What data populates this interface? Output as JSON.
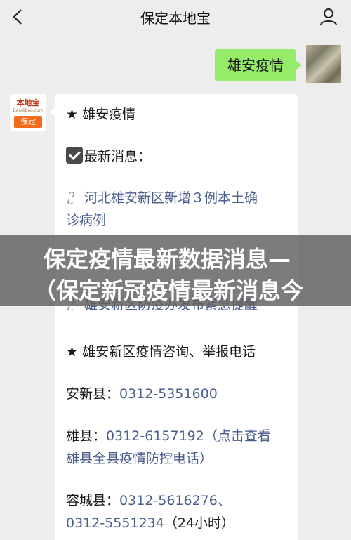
{
  "header": {
    "title": "保定本地宝",
    "back_icon": "chevron-left-icon",
    "user_icon": "user-icon"
  },
  "sent_message": {
    "text": "雄安疫情"
  },
  "bot_avatar": {
    "logo_text": "本地宝",
    "logo_sub": "Bendibao.com",
    "logo_badge": "保定"
  },
  "reply": {
    "heading": "★ 雄安疫情",
    "latest_label": "最新消息：",
    "links": [
      {
        "line1": "河北雄安新区新增３例本土确",
        "line2": "诊病例"
      },
      {
        "line1": "雄安新区防疫办发布紧急提醒",
        "line2": ""
      }
    ],
    "contact_heading": "★ 雄安新区疫情咨询、举报电话",
    "contacts": [
      {
        "label": "安新县：",
        "phone": "0312-5351600",
        "note": ""
      },
      {
        "label": "雄县：",
        "phone": "0312-6157192",
        "note": "（点击查看",
        "note2": "雄县全县疫情防控电话）"
      },
      {
        "label": "容城县：",
        "phone": "0312-5616276、",
        "phone2": "0312-5551234",
        "note": "（24小时）"
      }
    ]
  },
  "banner": {
    "line1": "保定疫情最新数据消息—",
    "line2": "（保定新冠疫情最新消息今"
  }
}
